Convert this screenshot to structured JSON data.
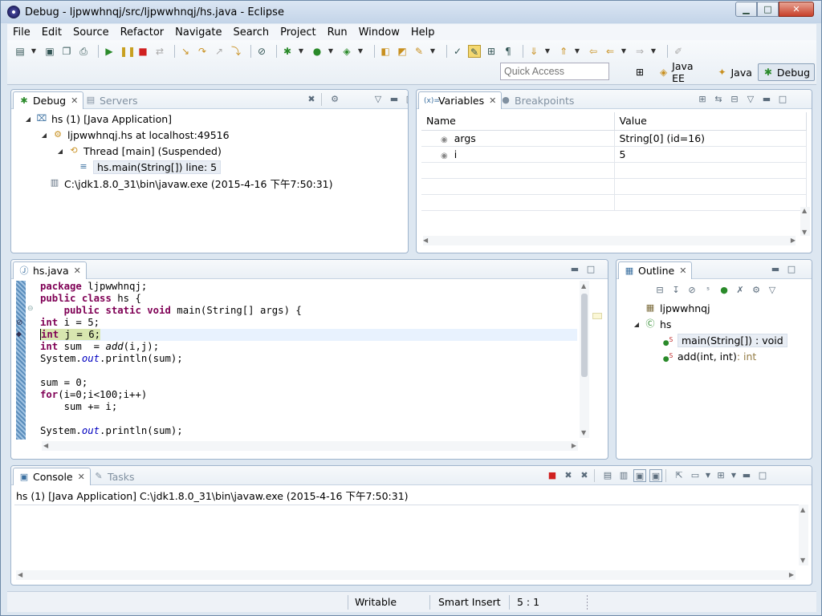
{
  "window": {
    "title": "Debug - ljpwwhnqj/src/ljpwwhnqj/hs.java - Eclipse",
    "min_label": "▁",
    "max_label": "□",
    "close_label": "✕"
  },
  "menu": [
    "File",
    "Edit",
    "Source",
    "Refactor",
    "Navigate",
    "Search",
    "Project",
    "Run",
    "Window",
    "Help"
  ],
  "quick_access": {
    "placeholder": "Quick Access"
  },
  "perspectives": [
    {
      "label": "Java EE",
      "icon": "java-ee-perspective-icon"
    },
    {
      "label": "Java",
      "icon": "java-perspective-icon"
    },
    {
      "label": "Debug",
      "icon": "debug-perspective-icon",
      "active": true
    }
  ],
  "debug_view": {
    "tabs": [
      {
        "label": "Debug",
        "active": true
      },
      {
        "label": "Servers",
        "active": false
      }
    ],
    "tree": [
      {
        "label": "hs (1) [Java Application]",
        "icon": "java-app-icon"
      },
      {
        "label": "ljpwwhnqj.hs at localhost:49516",
        "icon": "debug-target-icon"
      },
      {
        "label": "Thread [main] (Suspended)",
        "icon": "thread-icon"
      },
      {
        "label": "hs.main(String[]) line: 5",
        "icon": "stack-frame-icon"
      },
      {
        "label": "C:\\jdk1.8.0_31\\bin\\javaw.exe (2015-4-16 下午7:50:31)",
        "icon": "process-icon"
      }
    ]
  },
  "variables_view": {
    "tabs": [
      {
        "label": "Variables",
        "active": true
      },
      {
        "label": "Breakpoints",
        "active": false
      }
    ],
    "columns": [
      "Name",
      "Value"
    ],
    "rows": [
      {
        "name": "args",
        "value": "String[0]  (id=16)"
      },
      {
        "name": "i",
        "value": "5"
      }
    ]
  },
  "editor": {
    "tab": "hs.java",
    "current_line": 5
  },
  "outline_view": {
    "tab": "Outline",
    "tree": [
      {
        "label": "ljpwwhnqj",
        "icon": "package-icon"
      },
      {
        "label": "hs",
        "icon": "class-icon"
      },
      {
        "label": "main(String[]) : void",
        "icon": "public-static-method-icon"
      },
      {
        "label": "add(int, int)",
        "suffix": " : int",
        "icon": "public-static-method-icon"
      }
    ]
  },
  "console_view": {
    "tabs": [
      {
        "label": "Console",
        "active": true
      },
      {
        "label": "Tasks",
        "active": false
      }
    ],
    "header": "hs (1) [Java Application] C:\\jdk1.8.0_31\\bin\\javaw.exe (2015-4-16 下午7:50:31)"
  },
  "statusbar": {
    "writable": "Writable",
    "insert_mode": "Smart Insert",
    "position": "5 : 1"
  },
  "colors": {
    "keyword": "#7f0055",
    "field": "#0000c0",
    "current_line_bg": "#e8f2fe",
    "selection": "#d8e6b0"
  }
}
